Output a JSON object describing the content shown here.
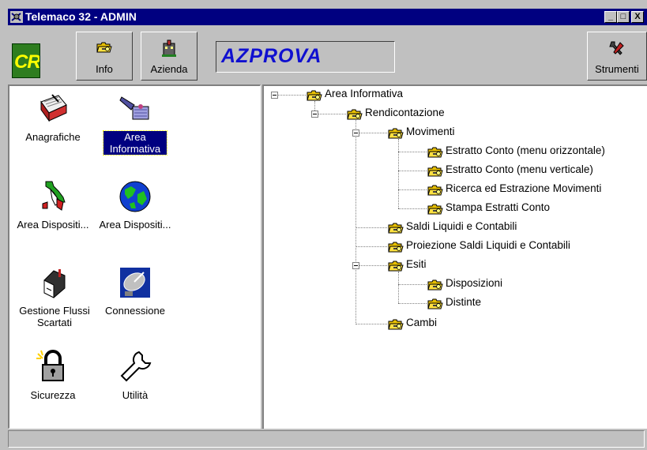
{
  "window": {
    "title": "Telemaco 32 - ADMIN"
  },
  "window_controls": {
    "minimize": "_",
    "maximize": "□",
    "close": "X"
  },
  "toolbar": {
    "logo_text": "CRI",
    "info_label": "Info",
    "azienda_label": "Azienda",
    "company_name": "AZPROVA",
    "strumenti_label": "Strumenti"
  },
  "left_icons": [
    {
      "label": "Anagrafiche",
      "icon": "address-book-icon"
    },
    {
      "label": "Area Informativa",
      "icon": "satellite-icon",
      "selected": true
    },
    {
      "label": "Area Dispositi...",
      "icon": "italy-map-icon"
    },
    {
      "label": "Area Dispositi...",
      "icon": "globe-icon"
    },
    {
      "label": "Gestione Flussi Scartati",
      "icon": "mailbox-icon"
    },
    {
      "label": "Connessione",
      "icon": "satellite-dish-icon"
    },
    {
      "label": "Sicurezza",
      "icon": "padlock-icon"
    },
    {
      "label": "Utilità",
      "icon": "wrench-icon"
    }
  ],
  "tree": [
    {
      "label": "Area Informativa",
      "level": 0,
      "expanded": true
    },
    {
      "label": "Rendicontazione",
      "level": 1,
      "expanded": true
    },
    {
      "label": "Movimenti",
      "level": 2,
      "expanded": true
    },
    {
      "label": "Estratto Conto (menu orizzontale)",
      "level": 3
    },
    {
      "label": "Estratto Conto (menu verticale)",
      "level": 3
    },
    {
      "label": "Ricerca ed Estrazione Movimenti",
      "level": 3
    },
    {
      "label": "Stampa Estratti Conto",
      "level": 3
    },
    {
      "label": "Saldi Liquidi e Contabili",
      "level": 2
    },
    {
      "label": "Proiezione Saldi Liquidi e Contabili",
      "level": 2
    },
    {
      "label": "Esiti",
      "level": 2,
      "expanded": true
    },
    {
      "label": "Disposizioni",
      "level": 3
    },
    {
      "label": "Distinte",
      "level": 3
    },
    {
      "label": "Cambi",
      "level": 2
    }
  ],
  "status": {
    "text": ""
  },
  "colors": {
    "titlebar": "#000080",
    "face": "#c0c0c0",
    "company_text": "#1010d0",
    "logo_bg": "#2e7d1f",
    "logo_text": "#ffff00"
  }
}
